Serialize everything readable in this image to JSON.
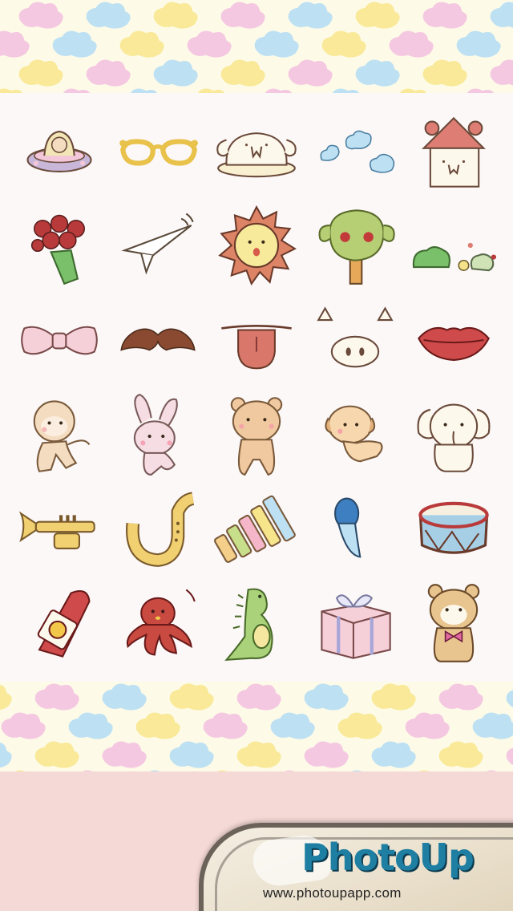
{
  "background": {
    "band_color": "#f5d9d6",
    "panel_color": "#fcf8f8",
    "cloud_colors": [
      "#f9e998",
      "#f5c8e2",
      "#bde0f3"
    ]
  },
  "stickers": [
    {
      "name": "ufo-monkey-sticker"
    },
    {
      "name": "glasses-sticker"
    },
    {
      "name": "elephant-hat-sticker"
    },
    {
      "name": "clouds-sticker"
    },
    {
      "name": "house-sticker"
    },
    {
      "name": "rose-bouquet-sticker"
    },
    {
      "name": "paper-plane-sticker"
    },
    {
      "name": "sun-sticker"
    },
    {
      "name": "apple-tree-sticker"
    },
    {
      "name": "bushes-sticker"
    },
    {
      "name": "bow-tie-sticker"
    },
    {
      "name": "mustache-sticker"
    },
    {
      "name": "tongue-sticker"
    },
    {
      "name": "pig-nose-sticker"
    },
    {
      "name": "lips-sticker"
    },
    {
      "name": "monkey-sticker"
    },
    {
      "name": "bunny-sticker"
    },
    {
      "name": "bear-sticker"
    },
    {
      "name": "puppy-sticker"
    },
    {
      "name": "elephant-sticker"
    },
    {
      "name": "trumpet-sticker"
    },
    {
      "name": "saxophone-sticker"
    },
    {
      "name": "xylophone-sticker"
    },
    {
      "name": "maraca-sticker"
    },
    {
      "name": "drum-sticker"
    },
    {
      "name": "rocket-sticker"
    },
    {
      "name": "octopus-sticker"
    },
    {
      "name": "dinosaur-sticker"
    },
    {
      "name": "gift-box-sticker"
    },
    {
      "name": "teddy-bear-sticker"
    }
  ],
  "banner": {
    "logo_text": "PhotoUp",
    "url": "www.photoupapp.com"
  }
}
